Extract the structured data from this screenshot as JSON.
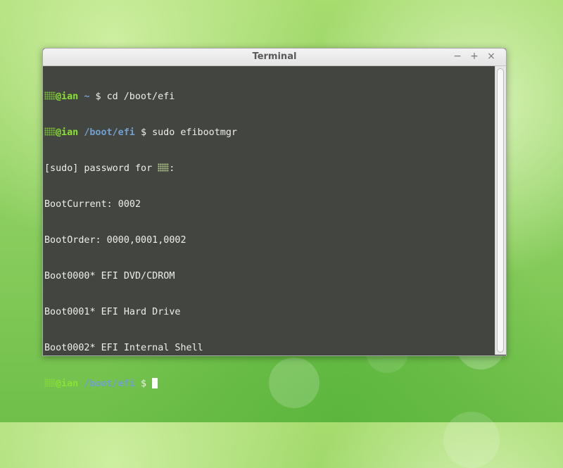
{
  "window": {
    "title": "Terminal",
    "buttons": {
      "minimize": "−",
      "maximize": "+",
      "close": "×"
    }
  },
  "terminal": {
    "line1": {
      "user": "@ian",
      "path": "~",
      "symbol": "$",
      "command": "cd /boot/efi"
    },
    "line2": {
      "user": "@ian",
      "path": "/boot/efi",
      "symbol": "$",
      "command": "sudo efibootmgr"
    },
    "line3": {
      "text": "[sudo] password for ",
      "suffix": ":"
    },
    "output": [
      "BootCurrent: 0002",
      "BootOrder: 0000,0001,0002",
      "Boot0000* EFI DVD/CDROM",
      "Boot0001* EFI Hard Drive",
      "Boot0002* EFI Internal Shell"
    ],
    "line9": {
      "user": "@ian",
      "path": "/boot/efi",
      "symbol": "$"
    }
  },
  "colors": {
    "user": "#8ae234",
    "path": "#729fcf",
    "terminal_bg": "#434540",
    "text": "#eeeeec"
  }
}
